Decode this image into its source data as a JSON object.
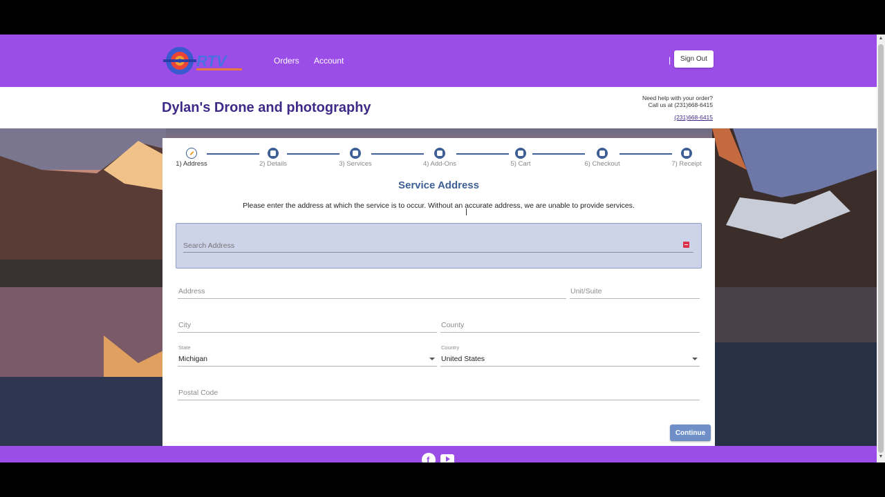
{
  "header": {
    "logo_text": "RTV",
    "nav": [
      "Orders",
      "Account"
    ],
    "separator": "|",
    "signout_label": "Sign Out",
    "brand_color": "#9b4de8"
  },
  "business": {
    "name": "Dylan's Drone and photography",
    "help_line1": "Need help with your order?",
    "help_line2": "Call us at (231)668-6415",
    "phone_link": "(231)668-6415"
  },
  "stepper": {
    "steps": [
      {
        "label": "1) Address",
        "icon": "pencil-icon",
        "active": true
      },
      {
        "label": "2) Details",
        "icon": "clipboard-icon",
        "active": false
      },
      {
        "label": "3) Services",
        "icon": "bag-icon",
        "active": false
      },
      {
        "label": "4) Add-Ons",
        "icon": "bag-plus-icon",
        "active": false
      },
      {
        "label": "5) Cart",
        "icon": "cart-icon",
        "active": false
      },
      {
        "label": "6) Checkout",
        "icon": "basket-icon",
        "active": false
      },
      {
        "label": "7) Receipt",
        "icon": "receipt-icon",
        "active": false
      }
    ]
  },
  "form": {
    "heading": "Service Address",
    "intro": "Please enter the address at which the service is to occur. Without an accurate address, we are unable to provide services.",
    "search_placeholder": "Search Address",
    "address_placeholder": "Address",
    "unit_placeholder": "Unit/Suite",
    "city_placeholder": "City",
    "county_placeholder": "County",
    "state_label": "State",
    "state_value": "Michigan",
    "country_label": "Country",
    "country_value": "United States",
    "postal_placeholder": "Postal Code",
    "continue_label": "Continue"
  },
  "footer": {
    "icons": [
      "facebook-icon",
      "youtube-icon"
    ],
    "facebook_glyph": "f"
  }
}
